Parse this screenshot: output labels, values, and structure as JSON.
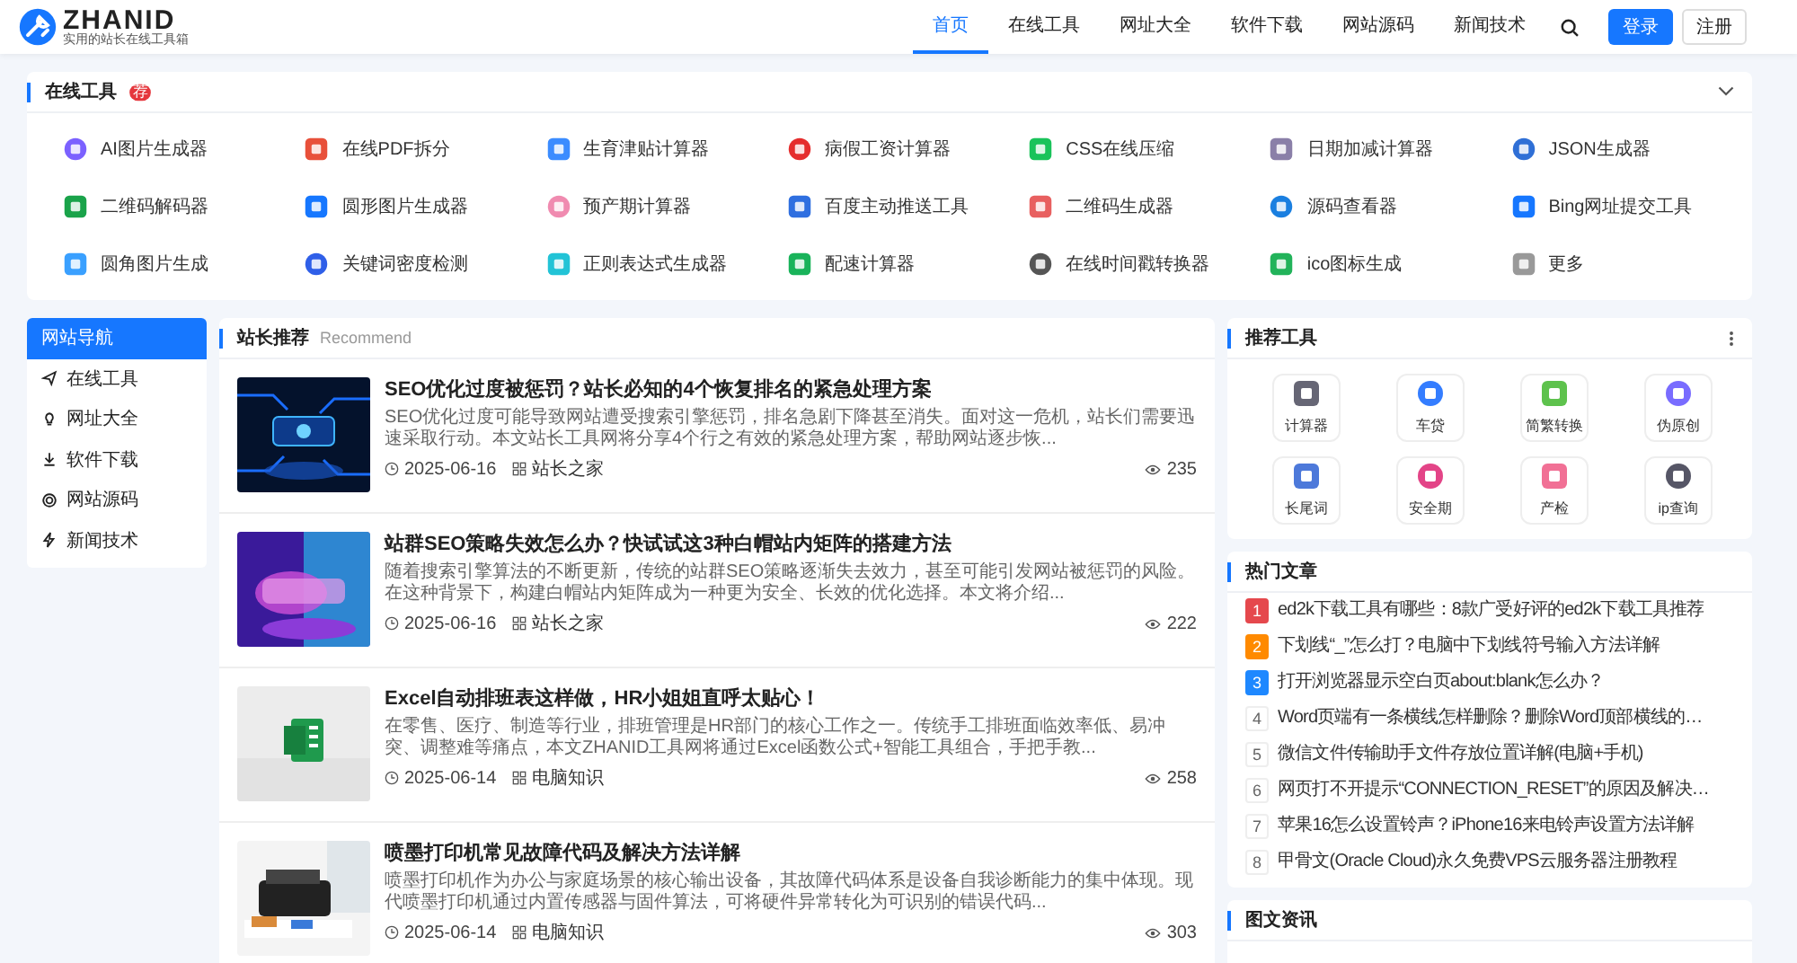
{
  "header": {
    "logo": "ZHANID",
    "tagline": "实用的站长在线工具箱",
    "nav": [
      {
        "label": "首页",
        "selected": true
      },
      {
        "label": "在线工具",
        "selected": false
      },
      {
        "label": "网址大全",
        "selected": false
      },
      {
        "label": "软件下载",
        "selected": false
      },
      {
        "label": "网站源码",
        "selected": false
      },
      {
        "label": "新闻技术",
        "selected": false
      }
    ],
    "login": "登录",
    "register": "注册"
  },
  "tools": {
    "title": "在线工具",
    "badge": "荐",
    "items": [
      "AI图片生成器",
      "在线PDF拆分",
      "生育津贴计算器",
      "病假工资计算器",
      "CSS在线压缩",
      "日期加减计算器",
      "JSON生成器",
      "二维码解码器",
      "圆形图片生成器",
      "预产期计算器",
      "百度主动推送工具",
      "二维码生成器",
      "源码查看器",
      "Bing网址提交工具",
      "圆角图片生成",
      "关键词密度检测",
      "正则表达式生成器",
      "配速计算器",
      "在线时间戳转换器",
      "ico图标生成",
      "更多"
    ]
  },
  "sidebar": {
    "items": [
      {
        "label": "网站导航",
        "selected": true
      },
      {
        "label": "在线工具",
        "selected": false
      },
      {
        "label": "网址大全",
        "selected": false
      },
      {
        "label": "软件下载",
        "selected": false
      },
      {
        "label": "网站源码",
        "selected": false
      },
      {
        "label": "新闻技术",
        "selected": false
      }
    ]
  },
  "recommend": {
    "title": "站长推荐",
    "subtitle": "Recommend",
    "articles": [
      {
        "title": "SEO优化过度被惩罚？站长必知的4个恢复排名的紧急处理方案",
        "summary": "SEO优化过度可能导致网站遭受搜索引擎惩罚，排名急剧下降甚至消失。面对这一危机，站长们需要迅速采取行动。本文站长工具网将分享4个行之有效的紧急处理方案，帮助网站逐步恢...",
        "date": "2025-06-16",
        "category": "站长之家",
        "views": "235"
      },
      {
        "title": "站群SEO策略失效怎么办？快试试这3种白帽站内矩阵的搭建方法",
        "summary": "随着搜索引擎算法的不断更新，传统的站群SEO策略逐渐失去效力，甚至可能引发网站被惩罚的风险。在这种背景下，构建白帽站内矩阵成为一种更为安全、长效的优化选择。本文将介绍...",
        "date": "2025-06-16",
        "category": "站长之家",
        "views": "222"
      },
      {
        "title": "Excel自动排班表这样做，HR小姐姐直呼太贴心！",
        "summary": "在零售、医疗、制造等行业，排班管理是HR部门的核心工作之一。传统手工排班面临效率低、易冲突、调整难等痛点，本文ZHANID工具网将通过Excel函数公式+智能工具组合，手把手教...",
        "date": "2025-06-14",
        "category": "电脑知识",
        "views": "258"
      },
      {
        "title": "喷墨打印机常见故障代码及解决方法详解",
        "summary": "喷墨打印机作为办公与家庭场景的核心输出设备，其故障代码体系是设备自我诊断能力的集中体现。现代喷墨打印机通过内置传感器与固件算法，可将硬件异常转化为可识别的错误代码...",
        "date": "2025-06-14",
        "category": "电脑知识",
        "views": "303"
      }
    ]
  },
  "recommended_tools": {
    "title": "推荐工具",
    "items": [
      "计算器",
      "车贷",
      "简繁转换",
      "伪原创",
      "长尾词",
      "安全期",
      "产检",
      "ip查询"
    ]
  },
  "hot_articles": {
    "title": "热门文章",
    "items": [
      {
        "rank": "1",
        "title": "ed2k下载工具有哪些：8款广受好评的ed2k下载工具推荐",
        "color": "#e5484d"
      },
      {
        "rank": "2",
        "title": "下划线“_”怎么打？电脑中下划线符号输入方法详解",
        "color": "#ff8a00"
      },
      {
        "rank": "3",
        "title": "打开浏览器显示空白页about:blank怎么办？",
        "color": "#1e88ff"
      },
      {
        "rank": "4",
        "title": "Word页端有一条横线怎样删除？删除Word顶部横线的…"
      },
      {
        "rank": "5",
        "title": "微信文件传输助手文件存放位置详解(电脑+手机)"
      },
      {
        "rank": "6",
        "title": "网页打不开提示“CONNECTION_RESET”的原因及解决…"
      },
      {
        "rank": "7",
        "title": "苹果16怎么设置铃声？iPhone16来电铃声设置方法详解"
      },
      {
        "rank": "8",
        "title": "甲骨文(Oracle Cloud)永久免费VPS云服务器注册教程"
      }
    ]
  },
  "news": {
    "title": "图文资讯"
  }
}
